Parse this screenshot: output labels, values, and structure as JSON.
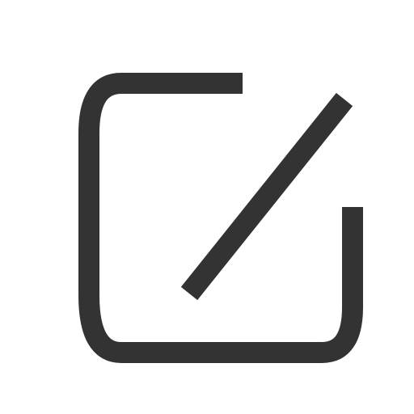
{
  "icon": {
    "name": "edit-icon",
    "color": "#333333",
    "background": "#ffffff"
  }
}
